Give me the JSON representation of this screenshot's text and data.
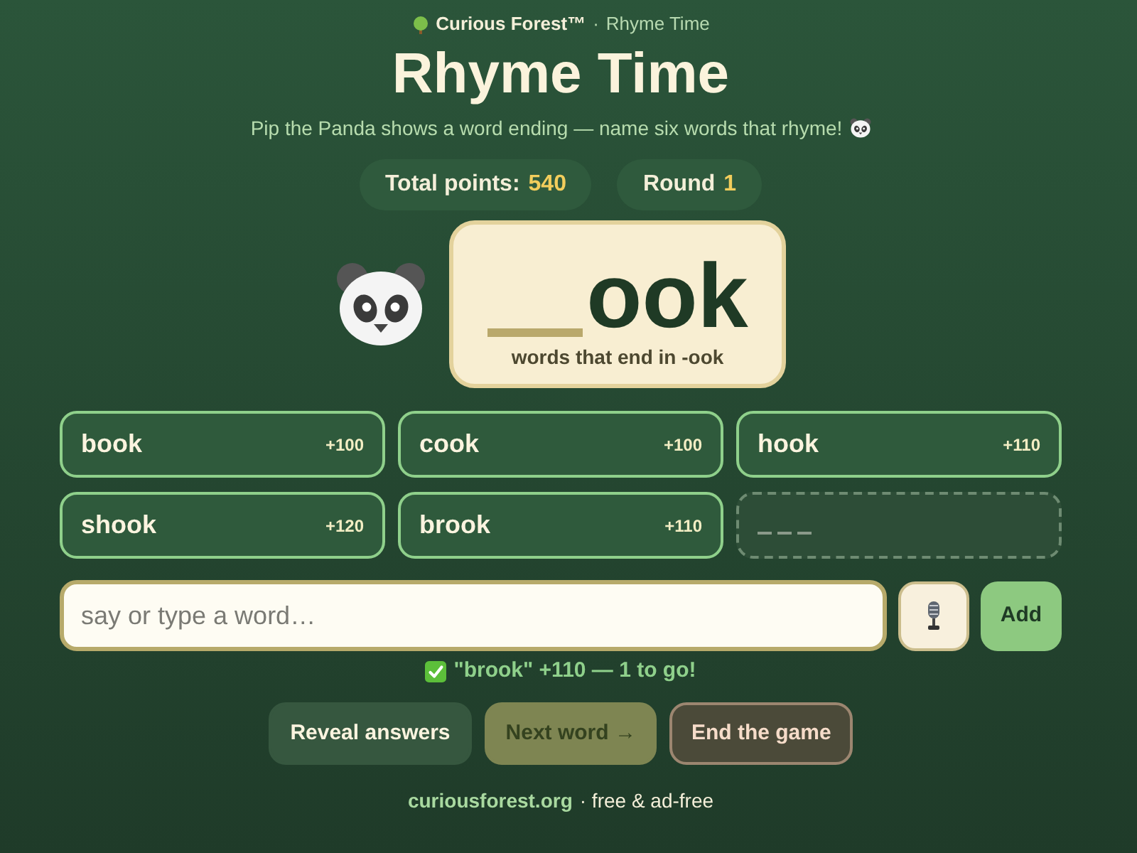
{
  "header": {
    "brand": "Curious Forest™",
    "separator": "·",
    "app": "Rhyme Time"
  },
  "title": "Rhyme Time",
  "subtitle": "Pip the Panda shows a word ending — name six words that rhyme!",
  "stats": [
    {
      "label": "Total points:",
      "value": "540"
    },
    {
      "label": "Round",
      "value": "1"
    }
  ],
  "puzzle": {
    "ending": "ook",
    "hint": "words that end in -ook"
  },
  "answers": [
    {
      "kind": "found",
      "word": "book",
      "points": "+100"
    },
    {
      "kind": "found",
      "word": "cook",
      "points": "+100"
    },
    {
      "kind": "found",
      "word": "hook",
      "points": "+110"
    },
    {
      "kind": "found",
      "word": "shook",
      "points": "+120"
    },
    {
      "kind": "found",
      "word": "brook",
      "points": "+110"
    },
    {
      "kind": "empty"
    }
  ],
  "input": {
    "placeholder": "say or type a word…"
  },
  "add_button": "Add",
  "feedback": {
    "kind": "success",
    "text": "\"brook\" +110 — 1 to go!"
  },
  "actions": [
    {
      "kind": "secondary",
      "label": "Reveal answers"
    },
    {
      "kind": "primary",
      "label": "Next word →"
    },
    {
      "kind": "danger",
      "label": "End the game"
    }
  ],
  "footer": {
    "link": "curiousforest.org",
    "text": "· free & ad-free"
  }
}
